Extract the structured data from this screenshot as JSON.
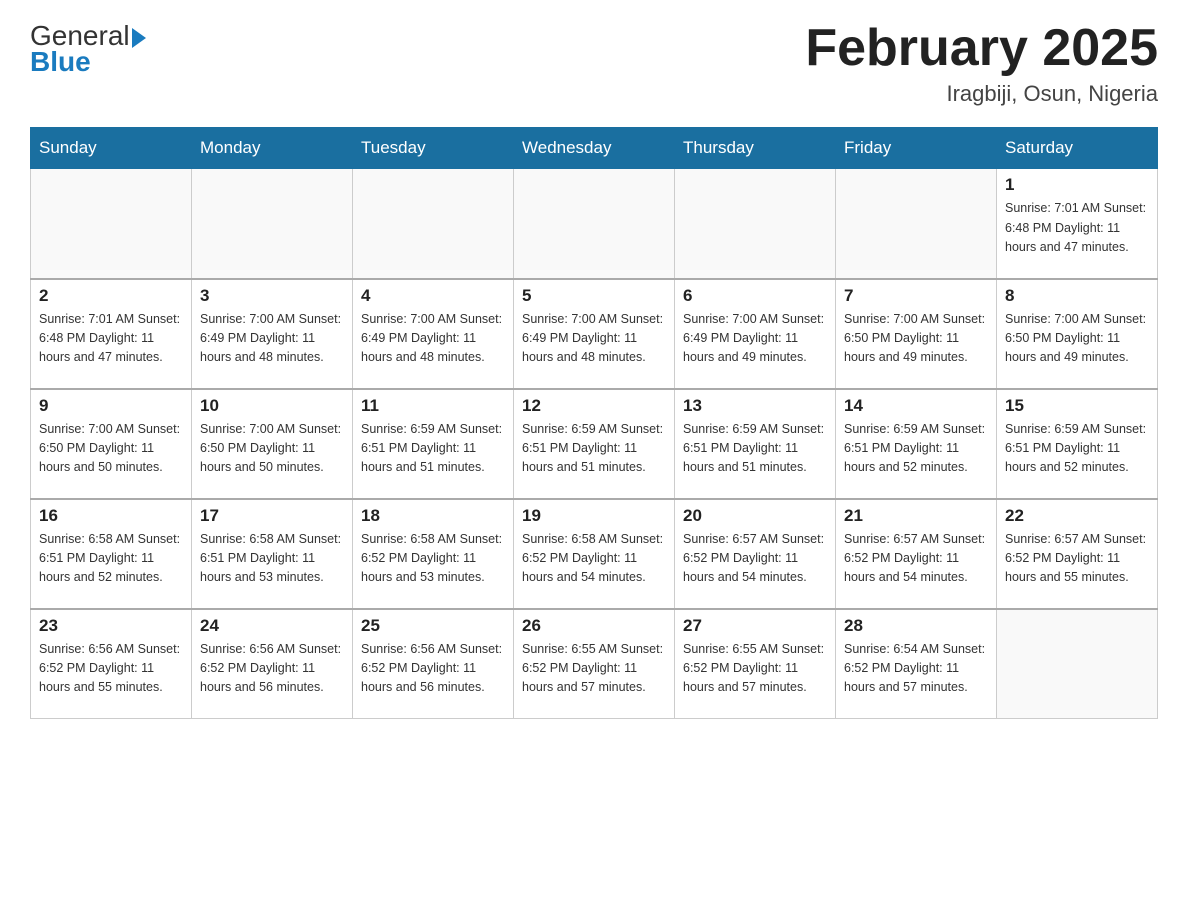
{
  "header": {
    "logo_general": "General",
    "logo_blue": "Blue",
    "month_title": "February 2025",
    "location": "Iragbiji, Osun, Nigeria"
  },
  "days_of_week": [
    "Sunday",
    "Monday",
    "Tuesday",
    "Wednesday",
    "Thursday",
    "Friday",
    "Saturday"
  ],
  "weeks": [
    {
      "days": [
        {
          "number": "",
          "info": ""
        },
        {
          "number": "",
          "info": ""
        },
        {
          "number": "",
          "info": ""
        },
        {
          "number": "",
          "info": ""
        },
        {
          "number": "",
          "info": ""
        },
        {
          "number": "",
          "info": ""
        },
        {
          "number": "1",
          "info": "Sunrise: 7:01 AM\nSunset: 6:48 PM\nDaylight: 11 hours\nand 47 minutes."
        }
      ]
    },
    {
      "days": [
        {
          "number": "2",
          "info": "Sunrise: 7:01 AM\nSunset: 6:48 PM\nDaylight: 11 hours\nand 47 minutes."
        },
        {
          "number": "3",
          "info": "Sunrise: 7:00 AM\nSunset: 6:49 PM\nDaylight: 11 hours\nand 48 minutes."
        },
        {
          "number": "4",
          "info": "Sunrise: 7:00 AM\nSunset: 6:49 PM\nDaylight: 11 hours\nand 48 minutes."
        },
        {
          "number": "5",
          "info": "Sunrise: 7:00 AM\nSunset: 6:49 PM\nDaylight: 11 hours\nand 48 minutes."
        },
        {
          "number": "6",
          "info": "Sunrise: 7:00 AM\nSunset: 6:49 PM\nDaylight: 11 hours\nand 49 minutes."
        },
        {
          "number": "7",
          "info": "Sunrise: 7:00 AM\nSunset: 6:50 PM\nDaylight: 11 hours\nand 49 minutes."
        },
        {
          "number": "8",
          "info": "Sunrise: 7:00 AM\nSunset: 6:50 PM\nDaylight: 11 hours\nand 49 minutes."
        }
      ]
    },
    {
      "days": [
        {
          "number": "9",
          "info": "Sunrise: 7:00 AM\nSunset: 6:50 PM\nDaylight: 11 hours\nand 50 minutes."
        },
        {
          "number": "10",
          "info": "Sunrise: 7:00 AM\nSunset: 6:50 PM\nDaylight: 11 hours\nand 50 minutes."
        },
        {
          "number": "11",
          "info": "Sunrise: 6:59 AM\nSunset: 6:51 PM\nDaylight: 11 hours\nand 51 minutes."
        },
        {
          "number": "12",
          "info": "Sunrise: 6:59 AM\nSunset: 6:51 PM\nDaylight: 11 hours\nand 51 minutes."
        },
        {
          "number": "13",
          "info": "Sunrise: 6:59 AM\nSunset: 6:51 PM\nDaylight: 11 hours\nand 51 minutes."
        },
        {
          "number": "14",
          "info": "Sunrise: 6:59 AM\nSunset: 6:51 PM\nDaylight: 11 hours\nand 52 minutes."
        },
        {
          "number": "15",
          "info": "Sunrise: 6:59 AM\nSunset: 6:51 PM\nDaylight: 11 hours\nand 52 minutes."
        }
      ]
    },
    {
      "days": [
        {
          "number": "16",
          "info": "Sunrise: 6:58 AM\nSunset: 6:51 PM\nDaylight: 11 hours\nand 52 minutes."
        },
        {
          "number": "17",
          "info": "Sunrise: 6:58 AM\nSunset: 6:51 PM\nDaylight: 11 hours\nand 53 minutes."
        },
        {
          "number": "18",
          "info": "Sunrise: 6:58 AM\nSunset: 6:52 PM\nDaylight: 11 hours\nand 53 minutes."
        },
        {
          "number": "19",
          "info": "Sunrise: 6:58 AM\nSunset: 6:52 PM\nDaylight: 11 hours\nand 54 minutes."
        },
        {
          "number": "20",
          "info": "Sunrise: 6:57 AM\nSunset: 6:52 PM\nDaylight: 11 hours\nand 54 minutes."
        },
        {
          "number": "21",
          "info": "Sunrise: 6:57 AM\nSunset: 6:52 PM\nDaylight: 11 hours\nand 54 minutes."
        },
        {
          "number": "22",
          "info": "Sunrise: 6:57 AM\nSunset: 6:52 PM\nDaylight: 11 hours\nand 55 minutes."
        }
      ]
    },
    {
      "days": [
        {
          "number": "23",
          "info": "Sunrise: 6:56 AM\nSunset: 6:52 PM\nDaylight: 11 hours\nand 55 minutes."
        },
        {
          "number": "24",
          "info": "Sunrise: 6:56 AM\nSunset: 6:52 PM\nDaylight: 11 hours\nand 56 minutes."
        },
        {
          "number": "25",
          "info": "Sunrise: 6:56 AM\nSunset: 6:52 PM\nDaylight: 11 hours\nand 56 minutes."
        },
        {
          "number": "26",
          "info": "Sunrise: 6:55 AM\nSunset: 6:52 PM\nDaylight: 11 hours\nand 57 minutes."
        },
        {
          "number": "27",
          "info": "Sunrise: 6:55 AM\nSunset: 6:52 PM\nDaylight: 11 hours\nand 57 minutes."
        },
        {
          "number": "28",
          "info": "Sunrise: 6:54 AM\nSunset: 6:52 PM\nDaylight: 11 hours\nand 57 minutes."
        },
        {
          "number": "",
          "info": ""
        }
      ]
    }
  ]
}
